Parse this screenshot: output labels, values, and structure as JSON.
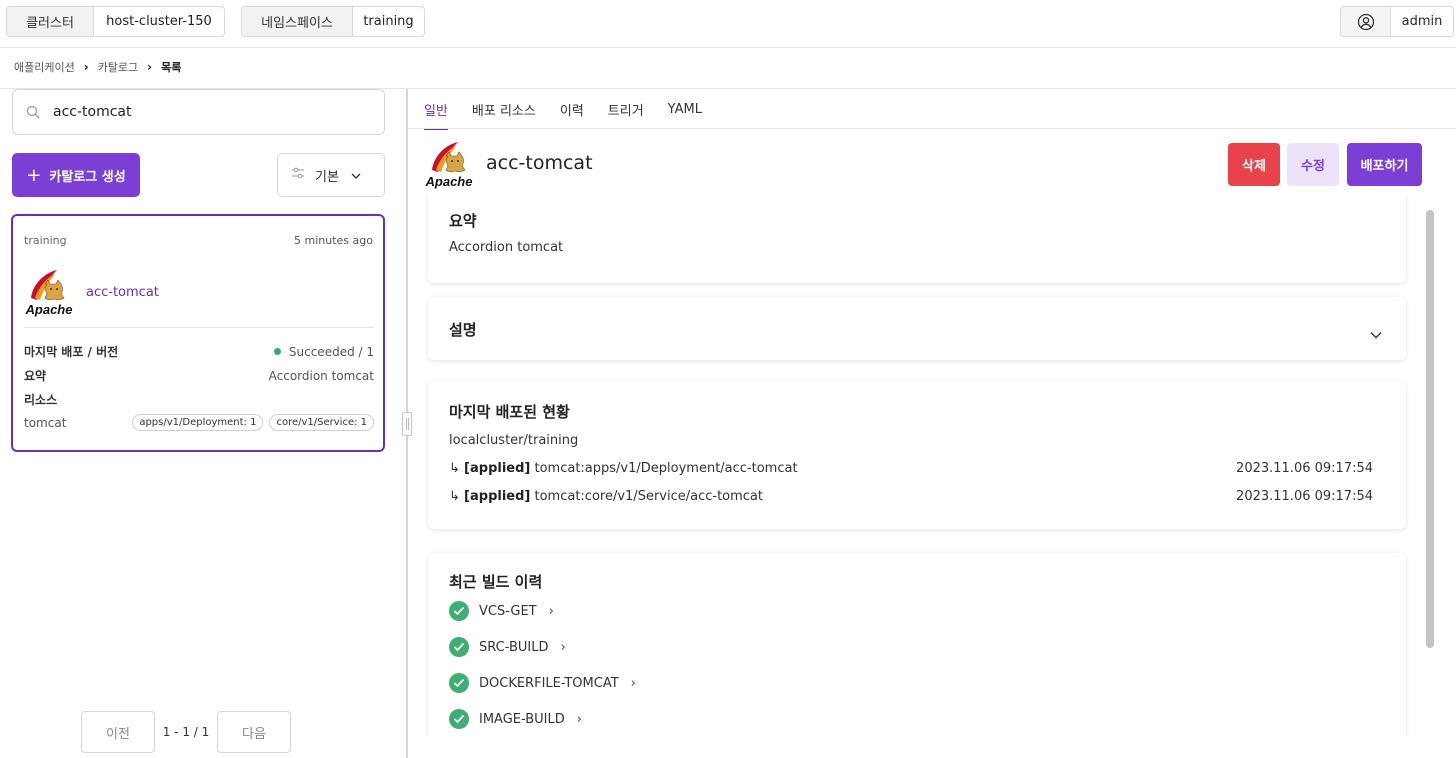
{
  "topbar": {
    "cluster_label": "클러스터",
    "cluster_value": "host-cluster-150",
    "namespace_label": "네임스페이스",
    "namespace_value": "training",
    "user": "admin"
  },
  "breadcrumb": [
    "애플리케이션",
    "카탈로그",
    "목록"
  ],
  "left": {
    "search_value": "acc-tomcat",
    "create_button": "카탈로그 생성",
    "sort_label": "기본",
    "card": {
      "namespace": "training",
      "time": "5 minutes ago",
      "name": "acc-tomcat",
      "last_deploy_label": "마지막 배포 / 버전",
      "last_deploy_value": "Succeeded / 1",
      "summary_label": "요약",
      "summary_value": "Accordion tomcat",
      "resources_label": "리소스",
      "resource_name": "tomcat",
      "resource_chips": [
        "apps/v1/Deployment: 1",
        "core/v1/Service: 1"
      ]
    },
    "pager": {
      "prev": "이전",
      "info": "1 - 1 / 1",
      "next": "다음"
    }
  },
  "tabs": [
    "일반",
    "배포 리소스",
    "이력",
    "트리거",
    "YAML"
  ],
  "detail": {
    "title": "acc-tomcat",
    "delete_button": "삭제",
    "edit_button": "수정",
    "deploy_button": "배포하기",
    "summary_title": "요약",
    "summary_text": "Accordion tomcat",
    "description_title": "설명",
    "last_deploy_title": "마지막 배포된 현황",
    "last_deploy_target": "localcluster/training",
    "deploy_rows": [
      {
        "arrow": "↳",
        "tag": "[applied]",
        "resource": "tomcat:apps/v1/Deployment/acc-tomcat",
        "time": "2023.11.06 09:17:54"
      },
      {
        "arrow": "↳",
        "tag": "[applied]",
        "resource": "tomcat:core/v1/Service/acc-tomcat",
        "time": "2023.11.06 09:17:54"
      }
    ],
    "builds_title": "최근 빌드 이력",
    "builds": [
      "VCS-GET",
      "SRC-BUILD",
      "DOCKERFILE-TOMCAT",
      "IMAGE-BUILD"
    ]
  },
  "logo": {
    "text": "Apache",
    "icon": "apache-tomcat-logo"
  },
  "colors": {
    "accent": "#7b3fd6",
    "danger": "#e8424b",
    "success": "#3fae72"
  }
}
